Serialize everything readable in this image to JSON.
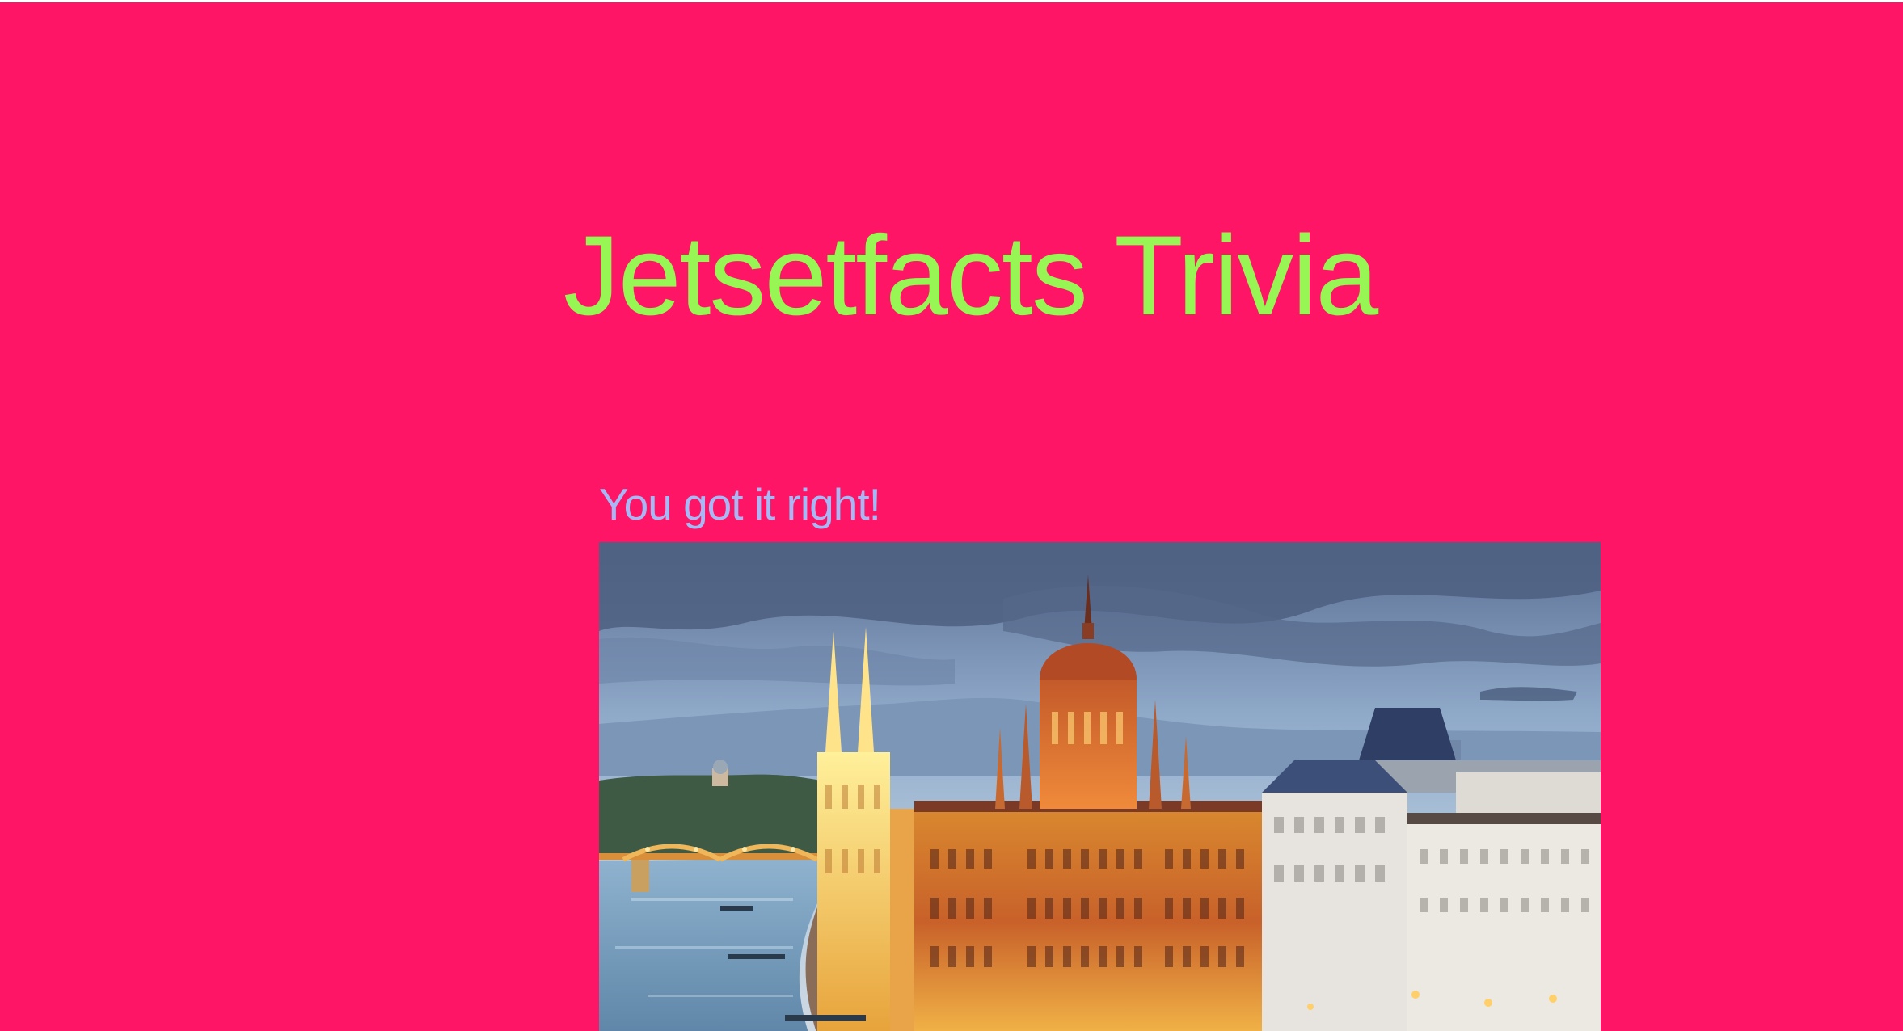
{
  "app": {
    "title": "Jetsetfacts Trivia"
  },
  "result": {
    "message": "You got it right!"
  },
  "image": {
    "subject": "Budapest Parliament building on the Danube river at dusk"
  },
  "colors": {
    "background": "#fe1565",
    "title": "#97f554",
    "result_text": "#a6b8f5"
  }
}
